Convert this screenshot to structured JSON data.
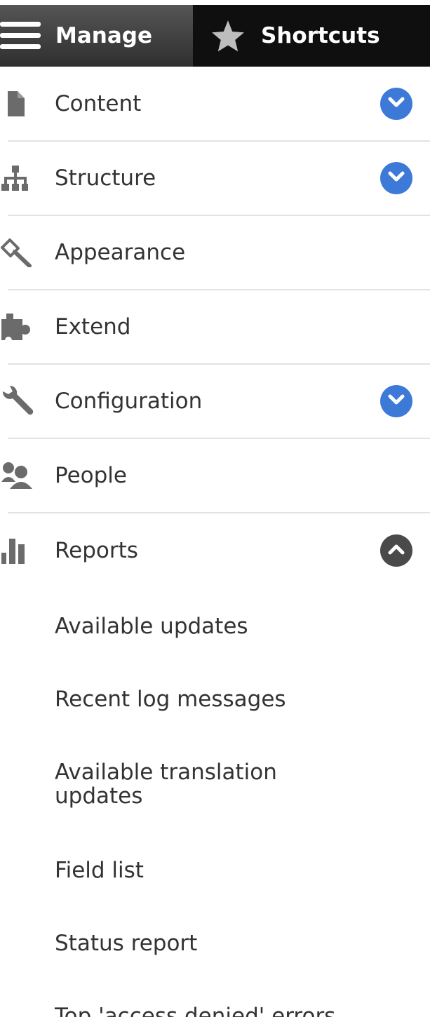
{
  "toolbar": {
    "manage_label": "Manage",
    "shortcuts_label": "Shortcuts",
    "manage_icon": "hamburger-icon",
    "shortcuts_icon": "star-icon",
    "manage_bg": "#444444",
    "shortcuts_bg": "#0f0f0f"
  },
  "menu": {
    "items": [
      {
        "label": "Content",
        "icon": "file-icon",
        "toggle": "expand",
        "toggle_color": "#3d7ad8"
      },
      {
        "label": "Structure",
        "icon": "sitemap-icon",
        "toggle": "expand",
        "toggle_color": "#3d7ad8"
      },
      {
        "label": "Appearance",
        "icon": "paintbrush-icon"
      },
      {
        "label": "Extend",
        "icon": "puzzle-icon"
      },
      {
        "label": "Configuration",
        "icon": "wrench-icon",
        "toggle": "expand",
        "toggle_color": "#3d7ad8"
      },
      {
        "label": "People",
        "icon": "people-icon"
      },
      {
        "label": "Reports",
        "icon": "bar-chart-icon",
        "toggle": "collapse",
        "toggle_color": "#4a4a4a"
      }
    ]
  },
  "reports_submenu": {
    "items": [
      {
        "label": "Available updates"
      },
      {
        "label": "Recent log messages"
      },
      {
        "label": "Available translation updates"
      },
      {
        "label": "Field list"
      },
      {
        "label": "Status report"
      },
      {
        "label": "Top 'access denied' errors"
      }
    ]
  }
}
